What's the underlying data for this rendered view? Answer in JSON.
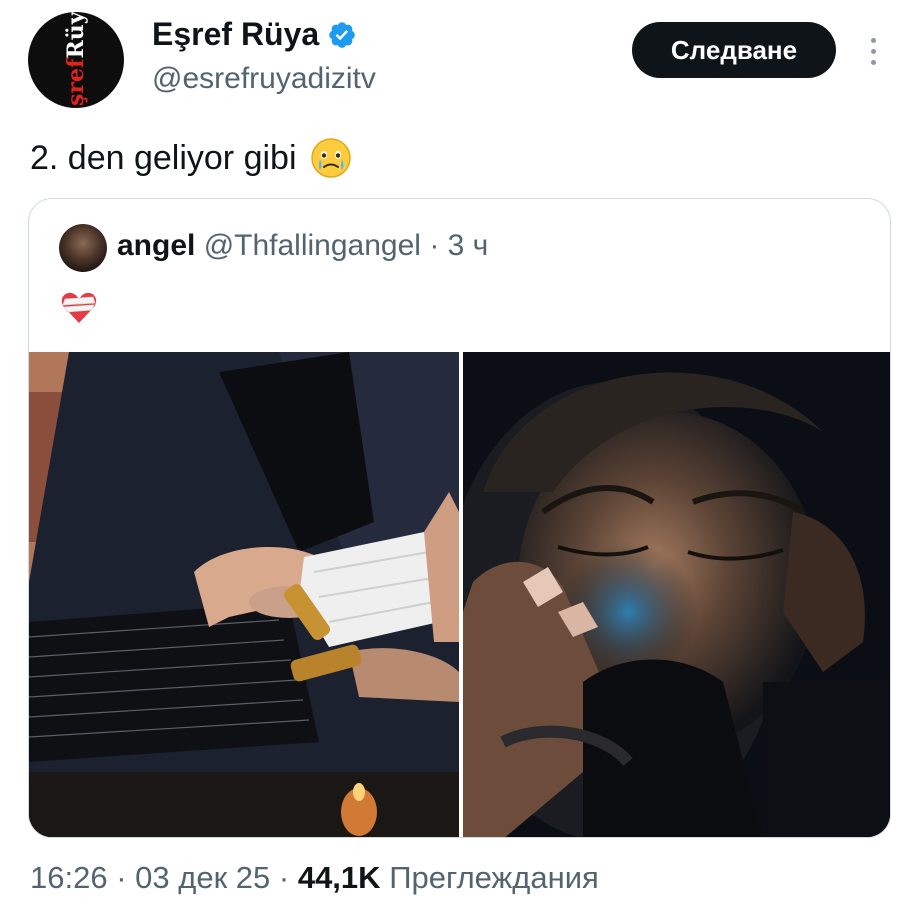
{
  "author": {
    "display_name": "Eşref Rüya",
    "handle": "@esrefruyadizitv",
    "logo_text_red": "Eşref",
    "logo_text_white": "Rüya",
    "verified_icon": "verified-badge-icon"
  },
  "follow_button": {
    "label": "Следване"
  },
  "tweet": {
    "text": "2. den geliyor gibi",
    "emoji_icon": "face-holding-back-tears-emoji"
  },
  "quoted": {
    "name": "angel",
    "handle": "@Thfallingangel",
    "separator": "·",
    "time": "3 ч",
    "emoji_icon": "bandaged-heart-emoji",
    "images": [
      "wrapped-hand-photo",
      "woman-crying-photo"
    ]
  },
  "meta": {
    "time": "16:26",
    "sep1": "·",
    "date": "03 дек 25",
    "sep2": "·",
    "views_count": "44,1K",
    "views_label": "Преглеждания"
  },
  "colors": {
    "text_primary": "#0f1419",
    "text_secondary": "#536471",
    "verified_blue": "#1d9bf0",
    "border": "#cfd9de",
    "button_bg": "#0f1419"
  }
}
